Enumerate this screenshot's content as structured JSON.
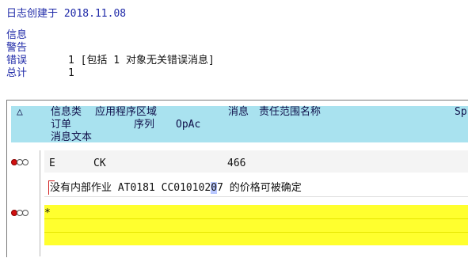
{
  "log": {
    "created_label": "日志创建于 2018.11.08"
  },
  "summary": {
    "info_label": "信息",
    "warning_label": "警告",
    "error_label": "错误",
    "total_label": "总计",
    "error_value": "1 [包括 1 对象无关错误消息]",
    "total_value": "1"
  },
  "grid": {
    "header": {
      "sort_icon": "△",
      "col_msgtype": "信息类",
      "col_area": "应用程序区域",
      "col_msgno": "消息",
      "col_resp": "责任范围名称",
      "col_sp": "Sp",
      "col_order": "订单",
      "col_seq": "序列",
      "col_opac": "OpAc",
      "col_msgtext": "消息文本"
    },
    "rows": [
      {
        "status": "error-traffic-light",
        "type": "E",
        "area": "CK",
        "msgno": "466",
        "text_before": "没有内部作业 AT0181 CC010102",
        "text_cursor": "0",
        "text_after": "7 的价格可被确定"
      },
      {
        "status": "error-traffic-light",
        "marker": "*"
      }
    ]
  },
  "colors": {
    "header_band": "#a9e2ef",
    "highlight_row": "#ffff2e",
    "label_blue": "#1f2aa8",
    "error_red": "#d01010"
  }
}
